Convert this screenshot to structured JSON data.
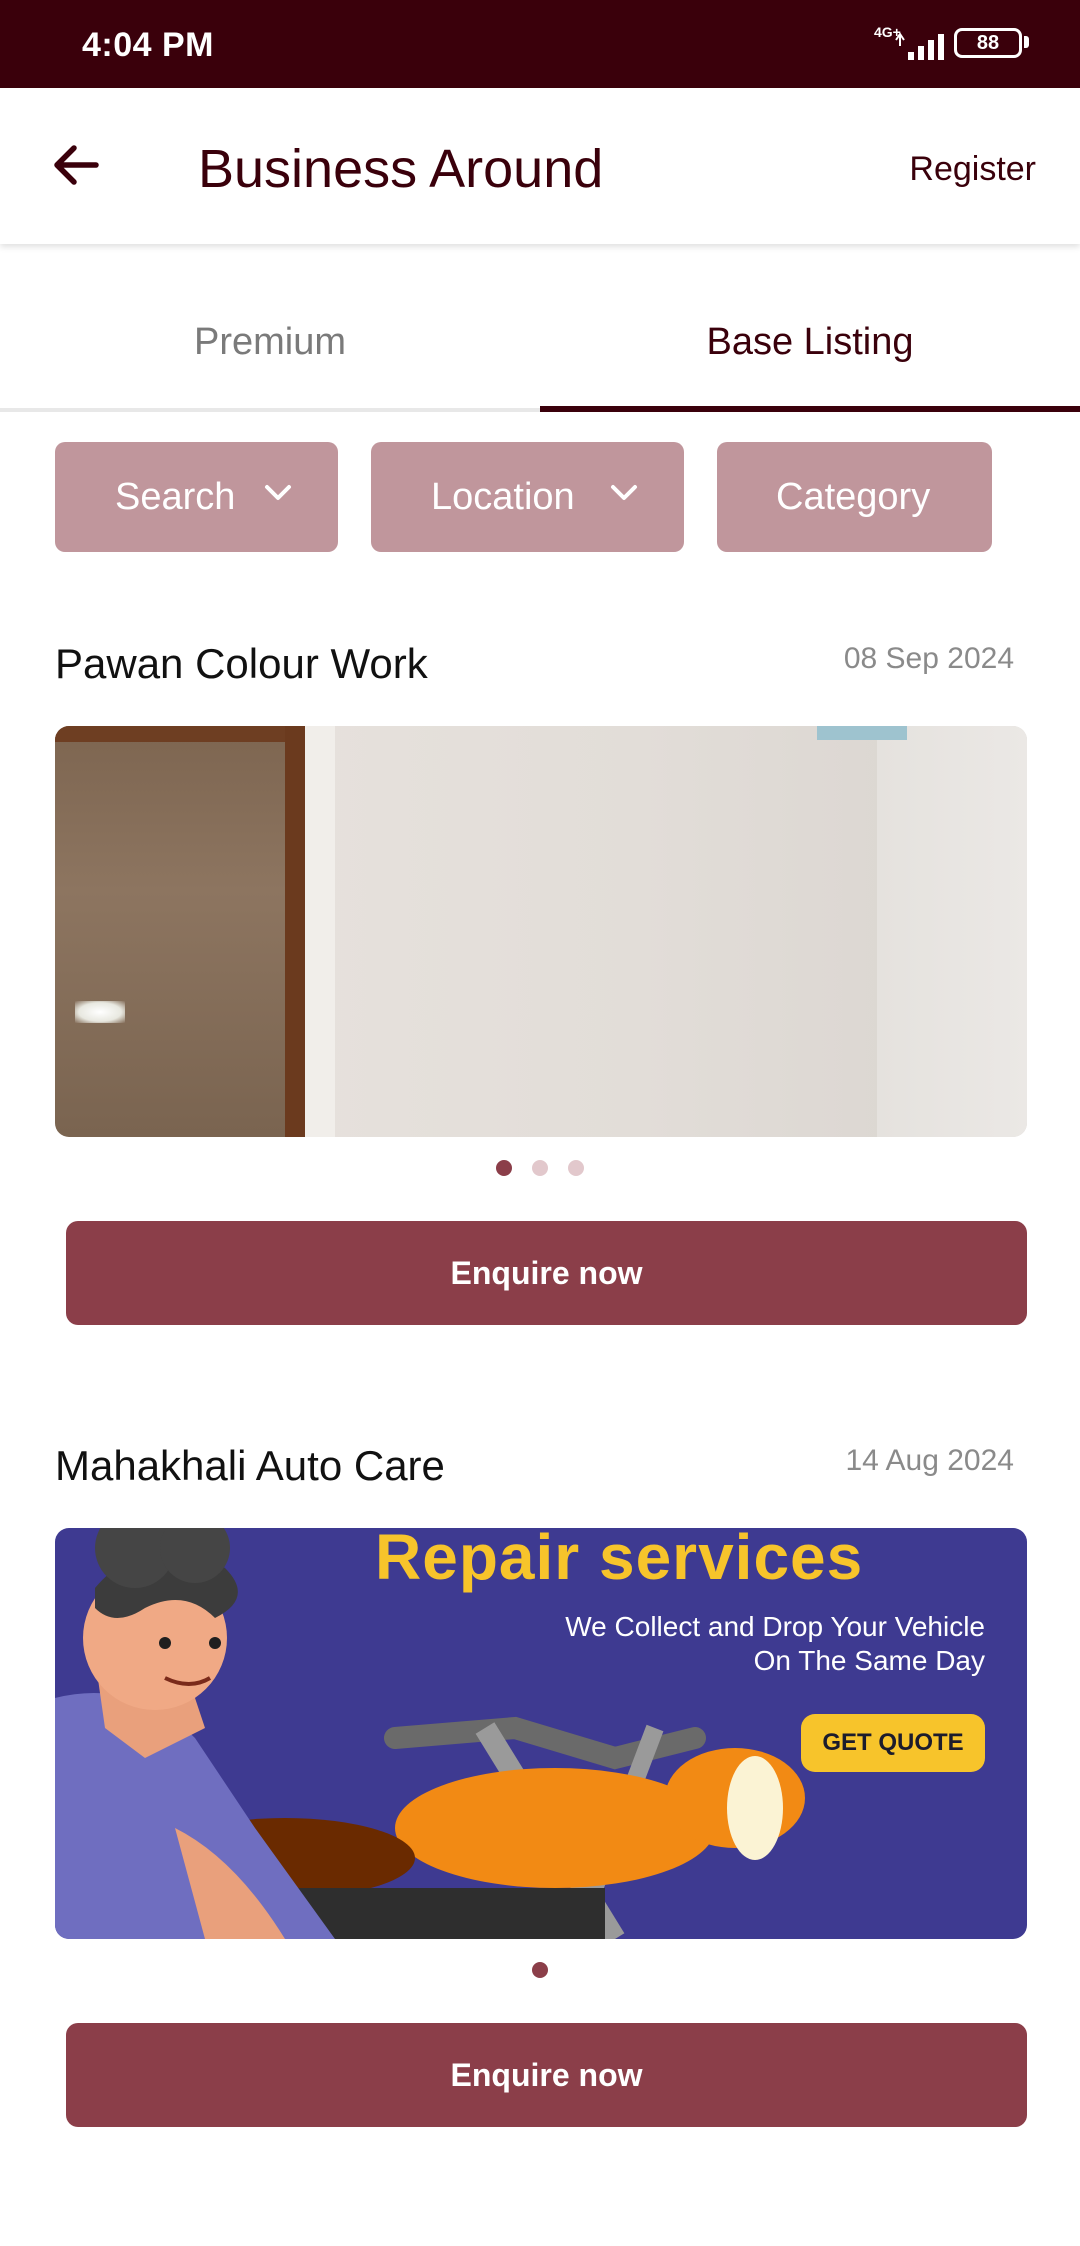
{
  "status_bar": {
    "time": "4:04 PM",
    "network": "4G+",
    "battery": "88"
  },
  "app_bar": {
    "title": "Business Around",
    "register_label": "Register"
  },
  "tabs": [
    {
      "label": "Premium",
      "selected": false
    },
    {
      "label": "Base Listing",
      "selected": true
    }
  ],
  "filters": {
    "search": "Search",
    "location": "Location",
    "category": "Category"
  },
  "listings": [
    {
      "title": "Pawan Colour Work",
      "date": "08 Sep 2024",
      "image_count": 3,
      "active_image": 1,
      "enquire_label": "Enquire now"
    },
    {
      "title": "Mahakhali Auto Care",
      "date": "14 Aug 2024",
      "image_count": 1,
      "active_image": 1,
      "enquire_label": "Enquire now",
      "banner": {
        "headline": "Repair services",
        "subtext": "We Collect and Drop Your Vehicle On The Same Day",
        "cta": "GET QUOTE"
      }
    }
  ],
  "colors": {
    "primary_dark": "#3a000b",
    "primary": "#8b3e49",
    "chip": "#c0969c"
  }
}
